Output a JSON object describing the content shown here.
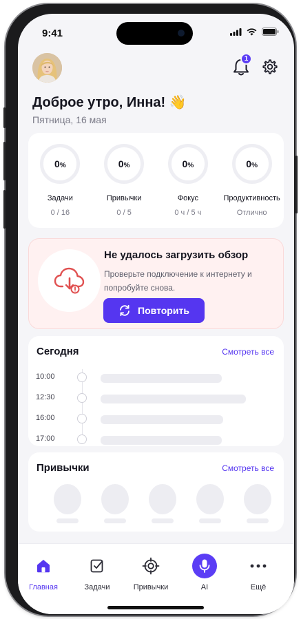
{
  "status": {
    "time": "9:41"
  },
  "header": {
    "notification_count": "1",
    "greeting": "Доброе утро, Инна! 👋",
    "date": "Пятница, 16 мая"
  },
  "stats": [
    {
      "value": "0",
      "unit": "%",
      "label": "Задачи",
      "detail": "0 / 16",
      "progress": 0
    },
    {
      "value": "0",
      "unit": "%",
      "label": "Привычки",
      "detail": "0 / 5",
      "progress": 0
    },
    {
      "value": "0",
      "unit": "%",
      "label": "Фокус",
      "detail": "0 ч / 5 ч",
      "progress": 0
    },
    {
      "value": "0",
      "unit": "%",
      "label": "Продуктивность",
      "detail": "Отлично",
      "progress": 0
    }
  ],
  "error": {
    "title": "Не удалось загрузить обзор",
    "text": "Проверьте подключение к интернету и попробуйте снова.",
    "retry_label": "Повторить",
    "icon": "cloud-error-icon"
  },
  "today": {
    "title": "Сегодня",
    "see_all": "Смотреть все",
    "times": [
      "10:00",
      "12:30",
      "16:00",
      "17:00"
    ]
  },
  "habits": {
    "title": "Привычки",
    "see_all": "Смотреть все"
  },
  "tabs": [
    {
      "label": "Главная",
      "icon": "home-icon",
      "active": true
    },
    {
      "label": "Задачи",
      "icon": "tasks-icon",
      "active": false
    },
    {
      "label": "Привычки",
      "icon": "target-icon",
      "active": false
    },
    {
      "label": "AI",
      "icon": "mic-icon",
      "active": false
    },
    {
      "label": "Ещё",
      "icon": "more-icon",
      "active": false
    }
  ],
  "colors": {
    "accent": "#5536f0",
    "error_bg": "#fff1f1",
    "error_icon": "#e05050"
  }
}
